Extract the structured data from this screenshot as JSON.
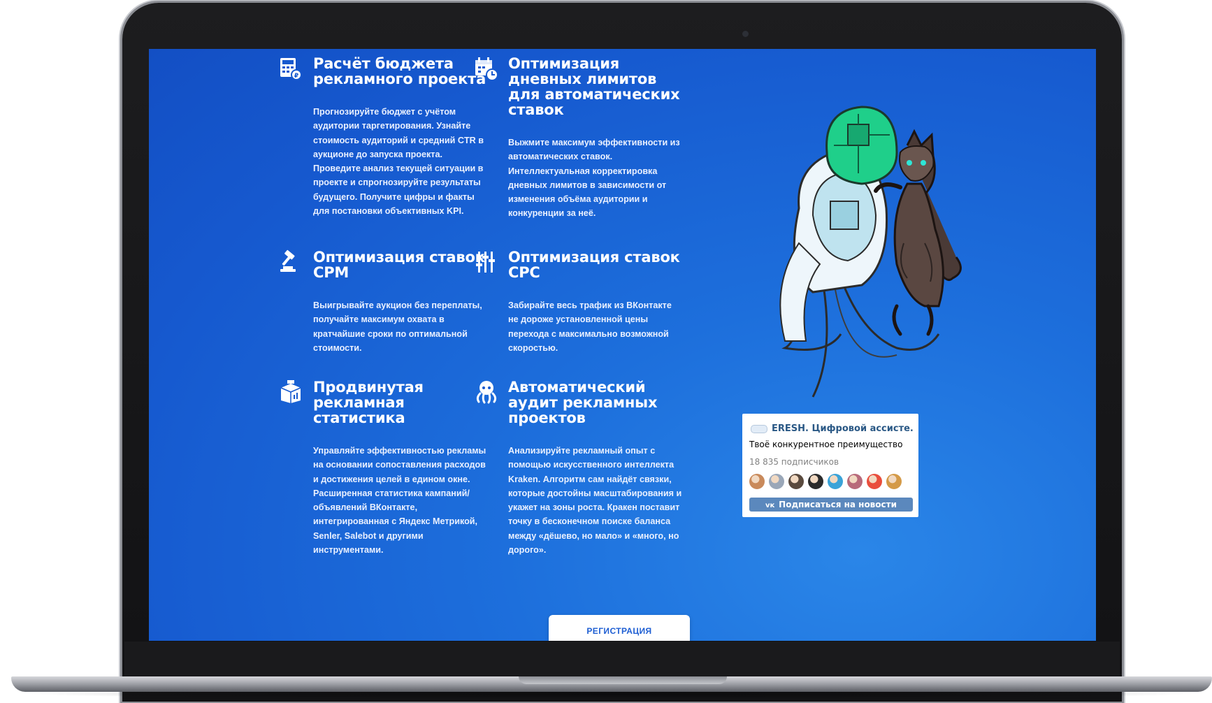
{
  "features": [
    {
      "icon": "calculator-icon",
      "title": "Расчёт бюджета рекламного проекта",
      "text": "Прогнозируйте бюджет с учётом аудитории таргетирования. Узнайте стоимость аудиторий и средний CTR в аукционе до запуска проекта. Проведите анализ текущей ситуации в проекте и спрогнозируйте результаты будущего. Получите цифры и факты для постановки объективных KPI."
    },
    {
      "icon": "calendar-clock-icon",
      "title": "Оптимизация дневных лимитов для автоматических ставок",
      "text": "Выжмите максимум эффективности из автоматических ставок. Интеллектуальная корректировка дневных лимитов в зависимости от изменения объёма аудитории и конкуренции за неё."
    },
    {
      "icon": "gavel-icon",
      "title": "Оптимизация ставок CPM",
      "text": "Выигрывайте аукцион без переплаты, получайте максимум охвата в кратчайшие сроки по оптимальной стоимости."
    },
    {
      "icon": "sliders-icon",
      "title": "Оптимизация ставок CPC",
      "text": "Забирайте весь трафик из ВКонтакте не дороже установленной цены перехода с максимально возможной скоростью."
    },
    {
      "icon": "statistics-box-icon",
      "title": "Продвинутая рекламная статистика",
      "text": "Управляйте эффективностью рекламы на основании сопоставления расходов и достижения целей в едином окне. Расширенная статистика кампаний/объявлений ВКонтакте, интегрированная с Яндекс Метрикой, Senler, Salebot и другими инструментами."
    },
    {
      "icon": "octopus-icon",
      "title": "Автоматический аудит рекламных проектов",
      "text": "Анализируйте рекламный опыт с помощью искусственного интеллекта Kraken. Алгоритм сам найдёт связки, которые достойны масштабирования и укажет на зоны роста. Кракен поставит точку в бесконечном поиске баланса между «дёшево, но мало» и «много, но дорого»."
    }
  ],
  "widget": {
    "title": "ERESH. Цифровой ассисте...",
    "subtitle": "Твоё конкурентное преимущество",
    "subscribers": "18 835 подписчиков",
    "subscribe_label": "Подписаться на новости",
    "avatar_colors": [
      "#c98a5b",
      "#9aa7b8",
      "#5a4a3e",
      "#2b2b2b",
      "#3aa3d8",
      "#b86a7a",
      "#e94e3c",
      "#d49a48"
    ]
  },
  "register_label": "РЕГИСТРАЦИЯ",
  "colors": {
    "screen_blue": "#1659cf",
    "accent_white": "#ffffff",
    "vk_blue": "#5b88bd"
  }
}
